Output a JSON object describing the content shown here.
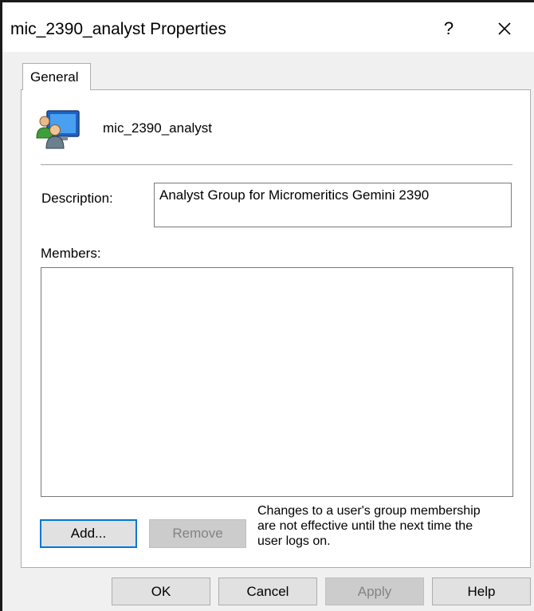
{
  "window": {
    "title": "mic_2390_analyst Properties",
    "help_label": "?",
    "close_icon": "close-icon"
  },
  "tabs": [
    {
      "label": "General",
      "selected": true
    }
  ],
  "group": {
    "icon": "user-group-icon",
    "name": "mic_2390_analyst"
  },
  "description": {
    "label": "Description:",
    "value": "Analyst Group for Micromeritics Gemini 2390"
  },
  "members": {
    "label": "Members:",
    "items": []
  },
  "buttons": {
    "add": "Add...",
    "remove": "Remove",
    "ok": "OK",
    "cancel": "Cancel",
    "apply": "Apply",
    "help": "Help"
  },
  "note": {
    "lines": [
      "Changes to a user's group membership",
      "are not effective until the next time the",
      "user logs on."
    ]
  },
  "colors": {
    "focus_border": "#0078d7",
    "disabled_text": "#838383",
    "dialog_background": "#f0f0f0"
  }
}
